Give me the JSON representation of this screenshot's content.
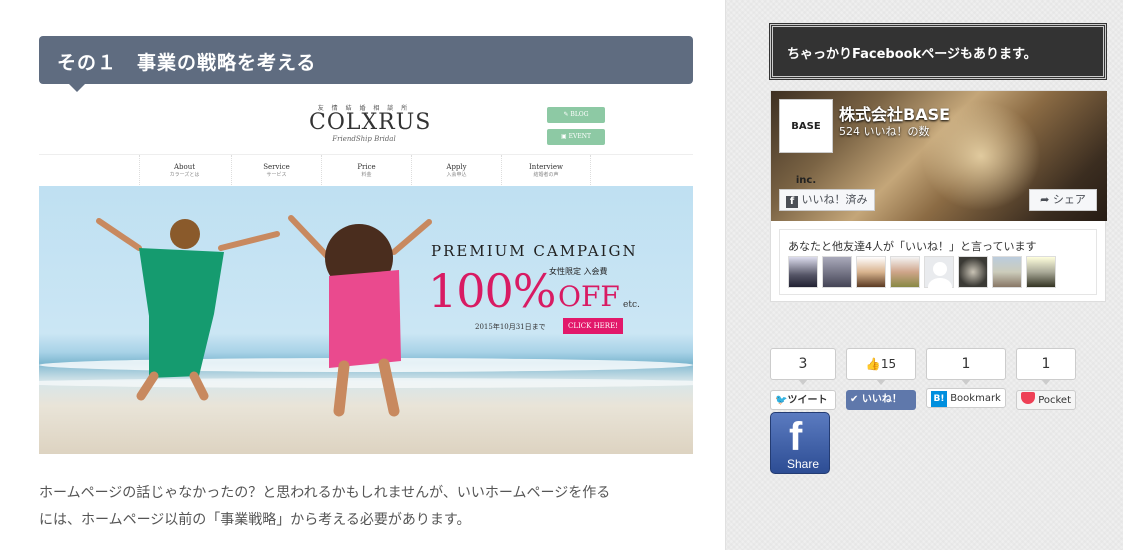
{
  "article": {
    "heading": "その１　事業の戦略を考える",
    "body_line1": "ホームページの話じゃなかったの？と思われるかもしれませんが、いいホームページを作る",
    "body_line2": "には、ホームページ以前の「事業戦略」から考える必要があります。"
  },
  "screenshot": {
    "logo_sub": "友 情 結 婚 相 談 所",
    "logo": "COLXRUS",
    "logo_tag": "FriendShip Bridal",
    "blog_btn": "✎ BLOG",
    "event_btn": "▣ EVENT",
    "nav": [
      {
        "en": "About",
        "jp": "カラーズとは"
      },
      {
        "en": "Service",
        "jp": "サービス"
      },
      {
        "en": "Price",
        "jp": "料金"
      },
      {
        "en": "Apply",
        "jp": "入会申込"
      },
      {
        "en": "Interview",
        "jp": "結婚者の声"
      }
    ],
    "campaign_title": "PREMIUM CAMPAIGN",
    "campaign_sub": "女性限定 入会費",
    "campaign_percent": "100%",
    "campaign_off": "OFF",
    "campaign_etc": "etc.",
    "campaign_date": "2015年10月31日まで",
    "campaign_click": "CLICK HERE!"
  },
  "sidebar": {
    "fb_title": "ちゃっかりFacebookページもあります。",
    "fb_page_name": "株式会社BASE",
    "fb_page_logo": "BASE inc.",
    "fb_likes": "524 いいね！の数",
    "fb_liked_btn": "いいね！済み",
    "fb_share_btn": "シェア",
    "fb_friends_text": "あなたと他友達4人が「いいね！」と言っています"
  },
  "share": {
    "tweet_count": "3",
    "tweet_label": "ツイート",
    "like_count": "15",
    "like_label": "いいね！",
    "hatena_count": "1",
    "hatena_label": "Bookmark",
    "pocket_count": "1",
    "pocket_label": "Pocket",
    "fb_share_label": "Share"
  },
  "colors": {
    "heading_bg": "#5f6c80",
    "campaign_pink": "#d81b63",
    "twitter_blue": "#55acee",
    "facebook_blue": "#3b5998",
    "hatena_blue": "#008fde",
    "pocket_red": "#ee4056"
  }
}
